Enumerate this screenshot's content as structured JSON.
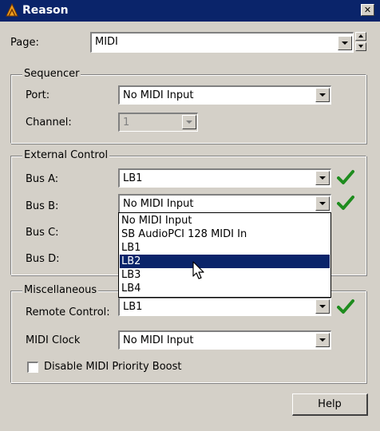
{
  "window": {
    "title": "Reason",
    "close_glyph": "✕"
  },
  "page_selector": {
    "label": "Page:",
    "value": "MIDI"
  },
  "sequencer": {
    "group_title": "Sequencer",
    "port": {
      "label": "Port:",
      "value": "No MIDI Input"
    },
    "channel": {
      "label": "Channel:",
      "value": "1"
    }
  },
  "external_control": {
    "group_title": "External Control",
    "bus_a": {
      "label": "Bus A:",
      "value": "LB1"
    },
    "bus_b": {
      "label": "Bus B:",
      "value": "No MIDI Input"
    },
    "bus_c": {
      "label": "Bus C:"
    },
    "bus_d": {
      "label": "Bus D:"
    }
  },
  "dropdown": {
    "options": [
      "No MIDI Input",
      "SB AudioPCI 128 MIDI In",
      "LB1",
      "LB2",
      "LB3",
      "LB4"
    ],
    "highlighted": "LB2"
  },
  "miscellaneous": {
    "group_title": "Miscellaneous",
    "remote_control": {
      "label": "Remote Control:",
      "value": "LB1"
    },
    "midi_clock": {
      "label": "MIDI Clock",
      "value": "No MIDI Input"
    },
    "disable_boost": {
      "label": "Disable MIDI Priority Boost",
      "checked": false
    }
  },
  "help_button": {
    "label": "Help"
  },
  "colors": {
    "titlebar": "#0a246a",
    "face": "#d4d0c8",
    "check_green": "#1e8c1e",
    "highlight": "#0a246a"
  },
  "icons": [
    "reason-app-icon",
    "close-icon",
    "chevron-down-icon",
    "spin-up-icon",
    "spin-down-icon",
    "green-checkmark-icon",
    "mouse-pointer-icon"
  ]
}
